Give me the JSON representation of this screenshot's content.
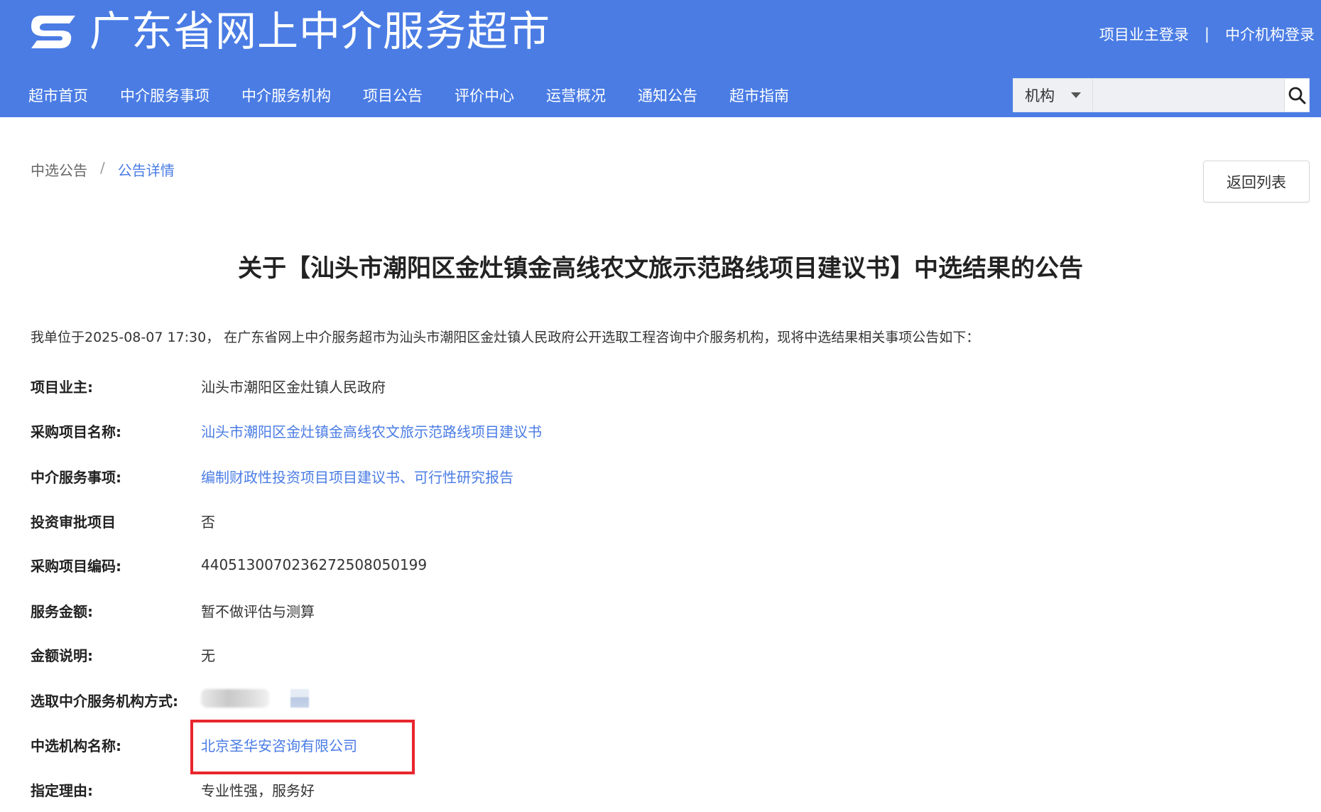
{
  "header": {
    "site_title": "广东省网上中介服务超市",
    "top_links": {
      "owner_login": "项目业主登录",
      "separator": "|",
      "agency_login": "中介机构登录"
    },
    "nav": [
      "超市首页",
      "中介服务事项",
      "中介服务机构",
      "项目公告",
      "评价中心",
      "运营概况",
      "通知公告",
      "超市指南"
    ],
    "search": {
      "category": "机构",
      "value": "",
      "icon": "search-icon"
    },
    "brand_color": "#4a7ce4"
  },
  "breadcrumb": {
    "parent": "中选公告",
    "separator": "/",
    "current": "公告详情"
  },
  "back_button": "返回列表",
  "notice": {
    "title": "关于【汕头市潮阳区金灶镇金高线农文旅示范路线项目建议书】中选结果的公告",
    "intro": "我单位于2025-08-07 17:30， 在广东省网上中介服务超市为汕头市潮阳区金灶镇人民政府公开选取工程咨询中介服务机构，现将中选结果相关事项公告如下：",
    "fields": [
      {
        "label": "项目业主:",
        "value": "汕头市潮阳区金灶镇人民政府"
      },
      {
        "label": "采购项目名称:",
        "value": "汕头市潮阳区金灶镇金高线农文旅示范路线项目建议书"
      },
      {
        "label": "中介服务事项:",
        "value": "编制财政性投资项目项目建议书、可行性研究报告"
      },
      {
        "label": "投资审批项目",
        "value": "否"
      },
      {
        "label": "采购项目编码:",
        "value": "440513007023627250805019​9"
      },
      {
        "label": "服务金额:",
        "value": "暂不做评估与测算"
      },
      {
        "label": "金额说明:",
        "value": "无"
      },
      {
        "label": "选取中介服务机构方式:",
        "value": ""
      },
      {
        "label": "中选机构名称:",
        "value": "北京圣华安咨询有限公司"
      },
      {
        "label": "指定理由:",
        "value": "专业性强，服务好"
      }
    ]
  },
  "highlight_color": "#e8262d"
}
